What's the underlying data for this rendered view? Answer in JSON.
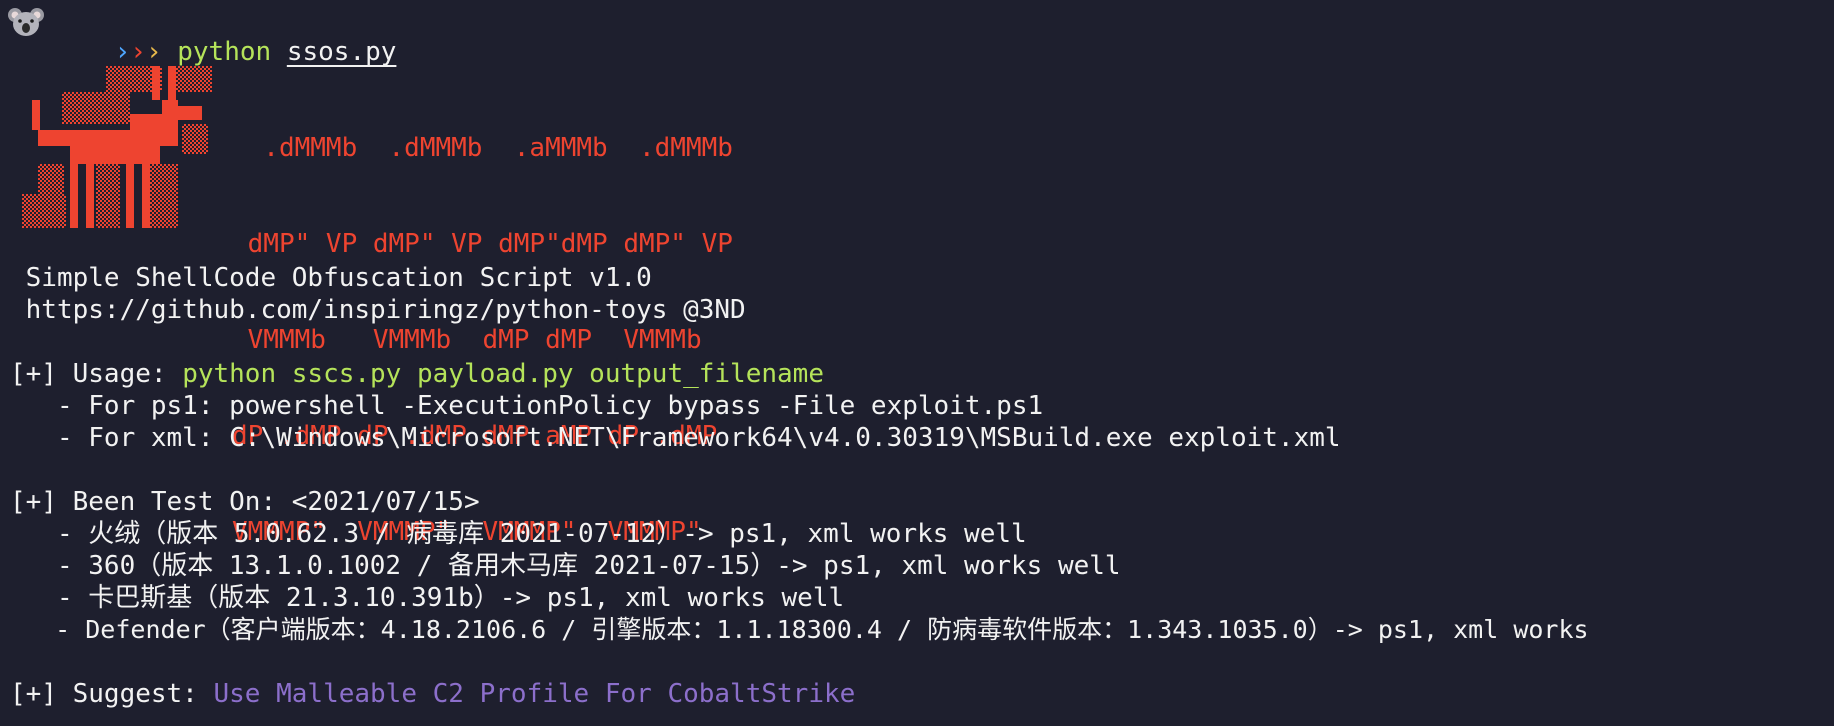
{
  "prompt": {
    "icon": "koala-icon",
    "arrows": "›››",
    "command": "python",
    "file": "ssos.py"
  },
  "ascii_art": [
    "  .dMMMb  .dMMMb  .aMMMb  .dMMMb",
    " dMP\" VP dMP\" VP dMP\"dMP dMP\" VP",
    " VMMMb   VMMMb  dMP dMP  VMMMb",
    "dP .dMP dP .dMP dMP.aMP dP .dMP",
    "VMMMP\"  VMMMP\"  VMMMP\"  VMMMP\""
  ],
  "banner": {
    "title": " Simple ShellCode Obfuscation Script v1.0",
    "url": " https://github.com/inspiringz/python-toys @3ND"
  },
  "usage": {
    "prefix": "[+] Usage: ",
    "command": "python sscs.py payload.py output_filename",
    "ps1": "   - For ps1: powershell -ExecutionPolicy bypass -File exploit.ps1",
    "xml": "   - For xml: C:\\Windows\\Microsoft.NET\\Framework64\\v4.0.30319\\MSBuild.exe exploit.xml"
  },
  "tested": {
    "header": "[+] Been Test On: <2021/07/15>",
    "items": [
      "   - 火绒（版本 5.0.62.3 / 病毒库 2021-07-12）-> ps1, xml works well",
      "   - 360（版本 13.1.0.1002 / 备用木马库 2021-07-15）-> ps1, xml works well",
      "   - 卡巴斯基（版本 21.3.10.391b）-> ps1, xml works well",
      "   - Defender（客户端版本：4.18.2106.6 / 引擎版本：1.1.18300.4 / 防病毒软件版本：1.343.1035.0）-> ps1, xml works"
    ]
  },
  "suggest": {
    "prefix": "[+] Suggest: ",
    "text": "Use Malleable C2 Profile For CobaltStrike"
  },
  "colors": {
    "background": "#1e1f2e",
    "green": "#b5e35a",
    "red": "#ee4430",
    "purple": "#8c6fcb",
    "text": "#f2f2f2"
  }
}
